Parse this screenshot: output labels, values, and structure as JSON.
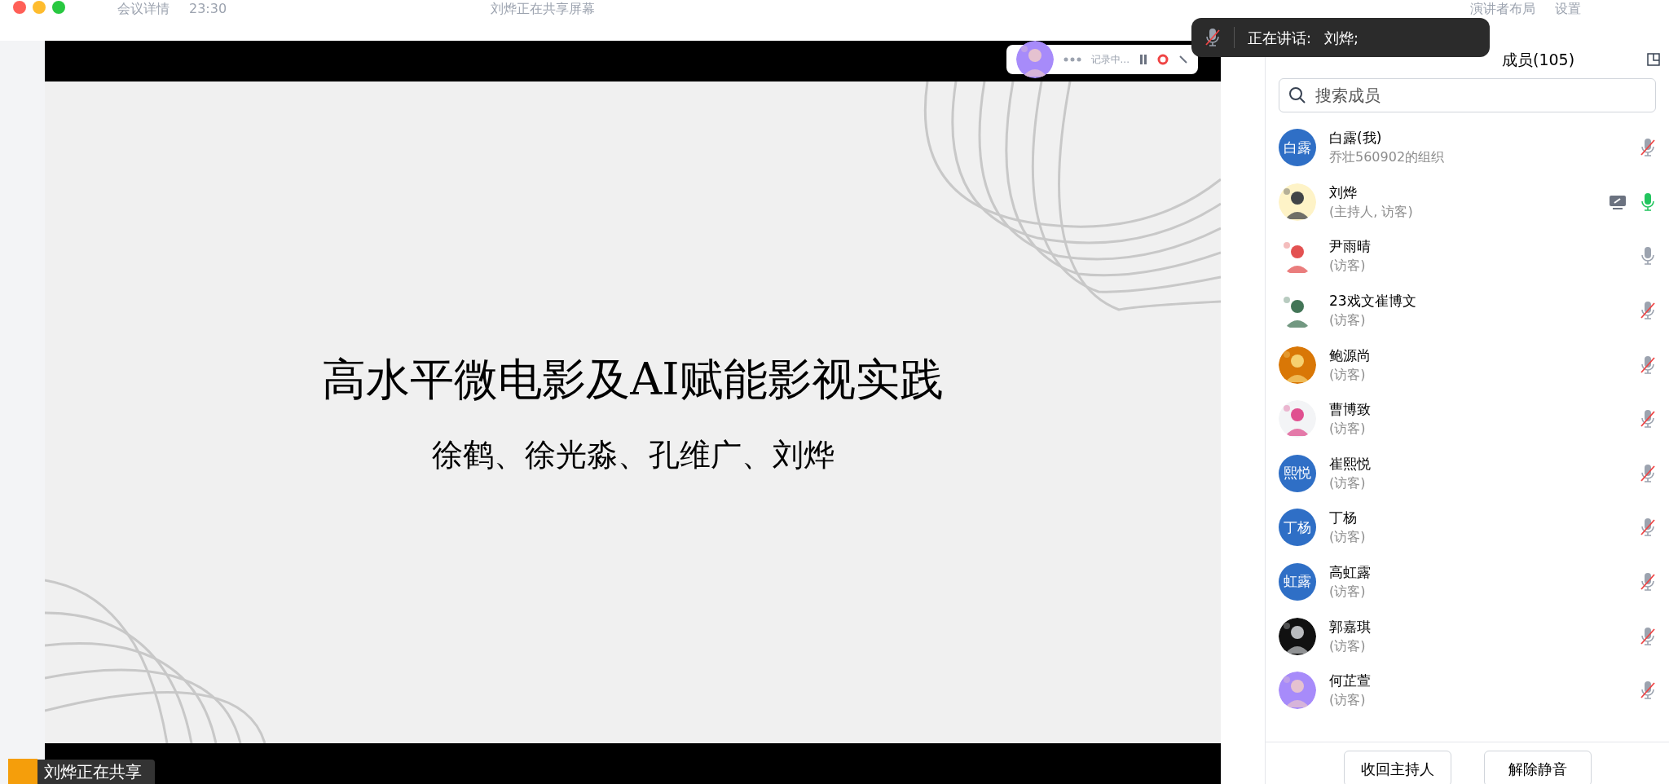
{
  "top_bar": {
    "meeting_info": "会议详情",
    "time": "23:30",
    "share_status": "刘烨正在共享屏幕",
    "layout": "演讲者布局",
    "settings": "设置"
  },
  "recording": {
    "status": "记录中..."
  },
  "slide": {
    "title": "高水平微电影及AI赋能影视实践",
    "authors": "徐鹤、徐光淼、孔维广、刘烨"
  },
  "sharing_bar": {
    "text": "刘烨正在共享"
  },
  "speaking_toast": {
    "label": "正在讲话:",
    "names": "刘烨;"
  },
  "members_panel": {
    "title": "成员(105)",
    "search": {
      "placeholder": "搜索成员"
    },
    "members": [
      {
        "name": "白露(我)",
        "role": "乔壮560902的组织",
        "avatar": {
          "kind": "text",
          "text": "白露"
        },
        "sharing": false,
        "muted": true,
        "speaking": false
      },
      {
        "name": "刘烨",
        "role": "(主持人, 访客)",
        "sharing": true,
        "muted": false,
        "speaking": true
      },
      {
        "name": "尹雨晴",
        "role": "(访客)",
        "sharing": false,
        "muted": false,
        "speaking": false
      },
      {
        "name": "23戏文崔博文",
        "role": "(访客)",
        "sharing": false,
        "muted": true,
        "speaking": false
      },
      {
        "name": "鲍源尚",
        "role": "(访客)",
        "sharing": false,
        "muted": true,
        "speaking": false
      },
      {
        "name": "曹博致",
        "role": "(访客)",
        "sharing": false,
        "muted": true,
        "speaking": false
      },
      {
        "name": "崔熙悦",
        "role": "(访客)",
        "avatar": {
          "kind": "text",
          "text": "熙悦"
        },
        "sharing": false,
        "muted": true,
        "speaking": false
      },
      {
        "name": "丁杨",
        "role": "(访客)",
        "avatar": {
          "kind": "text",
          "text": "丁杨"
        },
        "sharing": false,
        "muted": true,
        "speaking": false
      },
      {
        "name": "高虹露",
        "role": "(访客)",
        "avatar": {
          "kind": "text",
          "text": "虹露"
        },
        "sharing": false,
        "muted": true,
        "speaking": false
      },
      {
        "name": "郭嘉琪",
        "role": "(访客)",
        "sharing": false,
        "muted": true,
        "speaking": false
      },
      {
        "name": "何芷萱",
        "role": "(访客)",
        "sharing": false,
        "muted": true,
        "speaking": false
      }
    ],
    "buttons": [
      "收回主持人",
      "解除静音"
    ]
  }
}
